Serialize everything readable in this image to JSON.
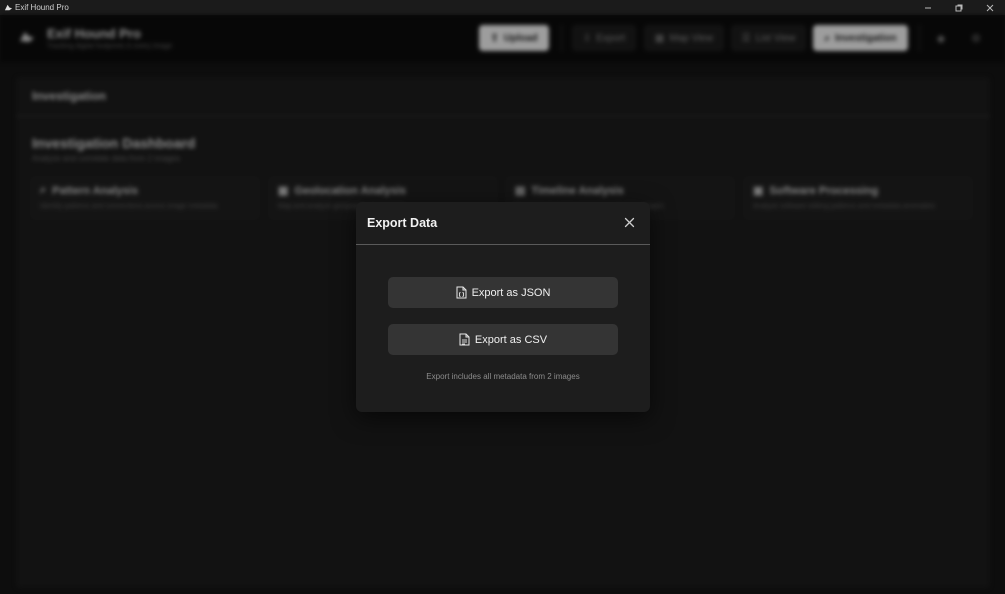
{
  "window": {
    "title": "Exif Hound Pro"
  },
  "header": {
    "brand_title": "Exif Hound Pro",
    "brand_subtitle": "Tracking digital footprints in every image",
    "nav": {
      "upload": "Upload",
      "export": "Export",
      "map_view": "Map View",
      "list_view": "List View",
      "investigation": "Investigation"
    }
  },
  "main": {
    "section_title": "Investigation",
    "dashboard_title": "Investigation Dashboard",
    "dashboard_subtitle": "Analyze and correlate data from 2 images",
    "cards": [
      {
        "title": "Pattern Analysis",
        "desc": "Identify patterns and connections across image metadata"
      },
      {
        "title": "Geolocation Analysis",
        "desc": "Map and analyze geographic data points"
      },
      {
        "title": "Timeline Analysis",
        "desc": "Reconstruct events chronologically from images"
      },
      {
        "title": "Software Processing",
        "desc": "Analyze software editing patterns and metadata anomalies"
      }
    ]
  },
  "modal": {
    "title": "Export Data",
    "export_json": "Export as JSON",
    "export_csv": "Export as CSV",
    "note": "Export includes all metadata from 2 images"
  }
}
